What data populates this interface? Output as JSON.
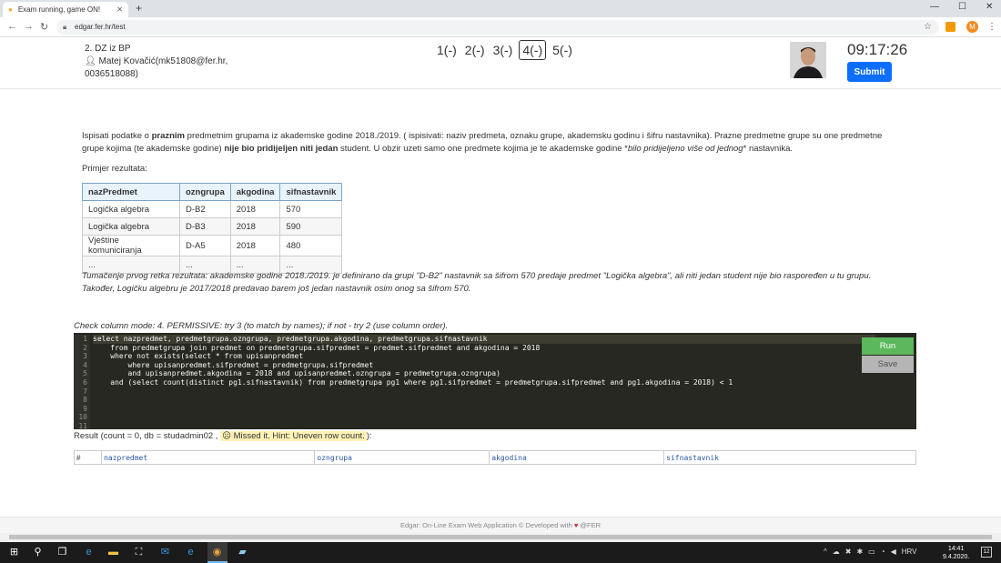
{
  "browser": {
    "tab_title": "Exam running, game ON!",
    "url": "edgar.fer.hr/test",
    "profile_initial": "M"
  },
  "header": {
    "exam_title": "2. DZ iz BP",
    "student": "Matej Kovačić(mk51808@fer.hr,",
    "student_id": "0036518088)",
    "questions": [
      "1(-)",
      "2(-)",
      "3(-)",
      "4(-)",
      "5(-)"
    ],
    "active_question_index": 3,
    "timer": "09:17:26",
    "submit_label": "Submit"
  },
  "question": {
    "p1_a": "Ispisati podatke o ",
    "p1_b": "praznim",
    "p1_c": " predmetnim grupama iz akademske godine 2018./2019. ( ispisivati: naziv predmeta, oznaku grupe, akademsku godinu i šifru nastavnika). Prazne predmetne grupe su one predmetne grupe kojima (te akademske godine) ",
    "p1_d": "nije bio pridijeljen niti jedan",
    "p1_e": " student. U obzir uzeti samo one predmete kojima je te akademske godine *",
    "p1_f": "bilo pridijeljeno više od jednog",
    "p1_g": "* nastavnika.",
    "example_label": "Primjer rezultata:",
    "table_headers": [
      "nazPredmet",
      "ozngrupa",
      "akgodina",
      "sifnastavnik"
    ],
    "table_rows": [
      [
        "Logička algebra",
        "D-B2",
        "2018",
        "570"
      ],
      [
        "Logička algebra",
        "D-B3",
        "2018",
        "590"
      ],
      [
        "Vještine komuniciranja",
        "D-A5",
        "2018",
        "480"
      ],
      [
        "...",
        "...",
        "...",
        "..."
      ]
    ],
    "interpretation": "Tumačenje prvog retka rezultata: akademske godine 2018./2019. je definirano da grupi \"D-B2\" nastavnik sa šifrom 570 predaje predmet \"Logička algebra\", ali niti jedan student nije bio raspoređen u tu grupu. Također, Logičku algebru je 2017/2018 predavao barem još jedan nastavnik osim onog sa šifrom 570."
  },
  "check_mode": "Check column mode: 4. PERMISSIVE: try 3 (to match by names); if not - try 2 (use column order).",
  "editor": {
    "lines": [
      "select nazpredmet, predmetgrupa.ozngrupa, predmetgrupa.akgodina, predmetgrupa.sifnastavnik",
      "    from predmetgrupa join predmet on predmetgrupa.sifpredmet = predmet.sifpredmet and akgodina = 2018",
      "    where not exists(select * from upisanpredmet",
      "        where upisanpredmet.sifpredmet = predmetgrupa.sifpredmet",
      "        and upisanpredmet.akgodina = 2018 and upisanpredmet.ozngrupa = predmetgrupa.ozngrupa)",
      "    and (select count(distinct pg1.sifnastavnik) from predmetgrupa pg1 where pg1.sifpredmet = predmetgrupa.sifpredmet and pg1.akgodina = 2018) < 1",
      "",
      "",
      "",
      "",
      ""
    ],
    "line_numbers": [
      "1",
      "2",
      "3",
      "4",
      "5",
      "6",
      "7",
      "8",
      "9",
      "10",
      "11"
    ],
    "run_label": "Run",
    "save_label": "Save"
  },
  "result": {
    "prefix": "Result (count = 0, db = studadmin02 , ",
    "hint": "☹ Missed it. Hint: Uneven row count.",
    "suffix": "):",
    "headers": [
      "#",
      "nazpredmet",
      "ozngrupa",
      "akgodina",
      "sifnastavnik"
    ]
  },
  "footer": {
    "text_a": "Edgar: On-Line Exam Web Application © Developed with ",
    "heart": "♥",
    "text_b": " @FER"
  },
  "taskbar": {
    "lang": "HRV",
    "time": "14:41",
    "date": "9.4.2020.",
    "notifications": "12"
  }
}
